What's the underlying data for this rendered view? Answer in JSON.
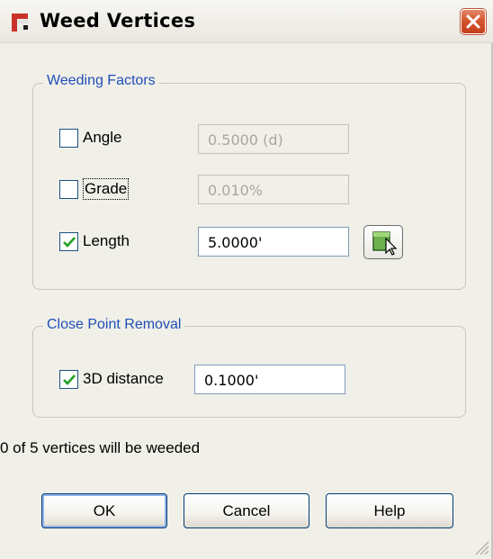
{
  "window": {
    "title": "Weed Vertices",
    "app_icon": "civil3d-app-icon",
    "close_icon": "close-x-icon"
  },
  "weeding_factors": {
    "title": "Weeding Factors",
    "rows": [
      {
        "label": "Angle",
        "checked": false,
        "value": "0.5000 (d)",
        "enabled": false
      },
      {
        "label": "Grade",
        "checked": false,
        "value": "0.010%",
        "enabled": false
      },
      {
        "label": "Length",
        "checked": true,
        "value": "5.0000'",
        "enabled": true
      }
    ],
    "pick_icon": "pick-in-drawing-icon"
  },
  "close_point_removal": {
    "title": "Close Point Removal",
    "label": "3D distance",
    "checked": true,
    "value": "0.1000'"
  },
  "status": "0 of 5 vertices will be weeded",
  "buttons": {
    "ok": "OK",
    "cancel": "Cancel",
    "help": "Help"
  },
  "colors": {
    "group_title": "#1f4fb8",
    "checkmark": "#21a121",
    "close_button": "#d5552e"
  }
}
